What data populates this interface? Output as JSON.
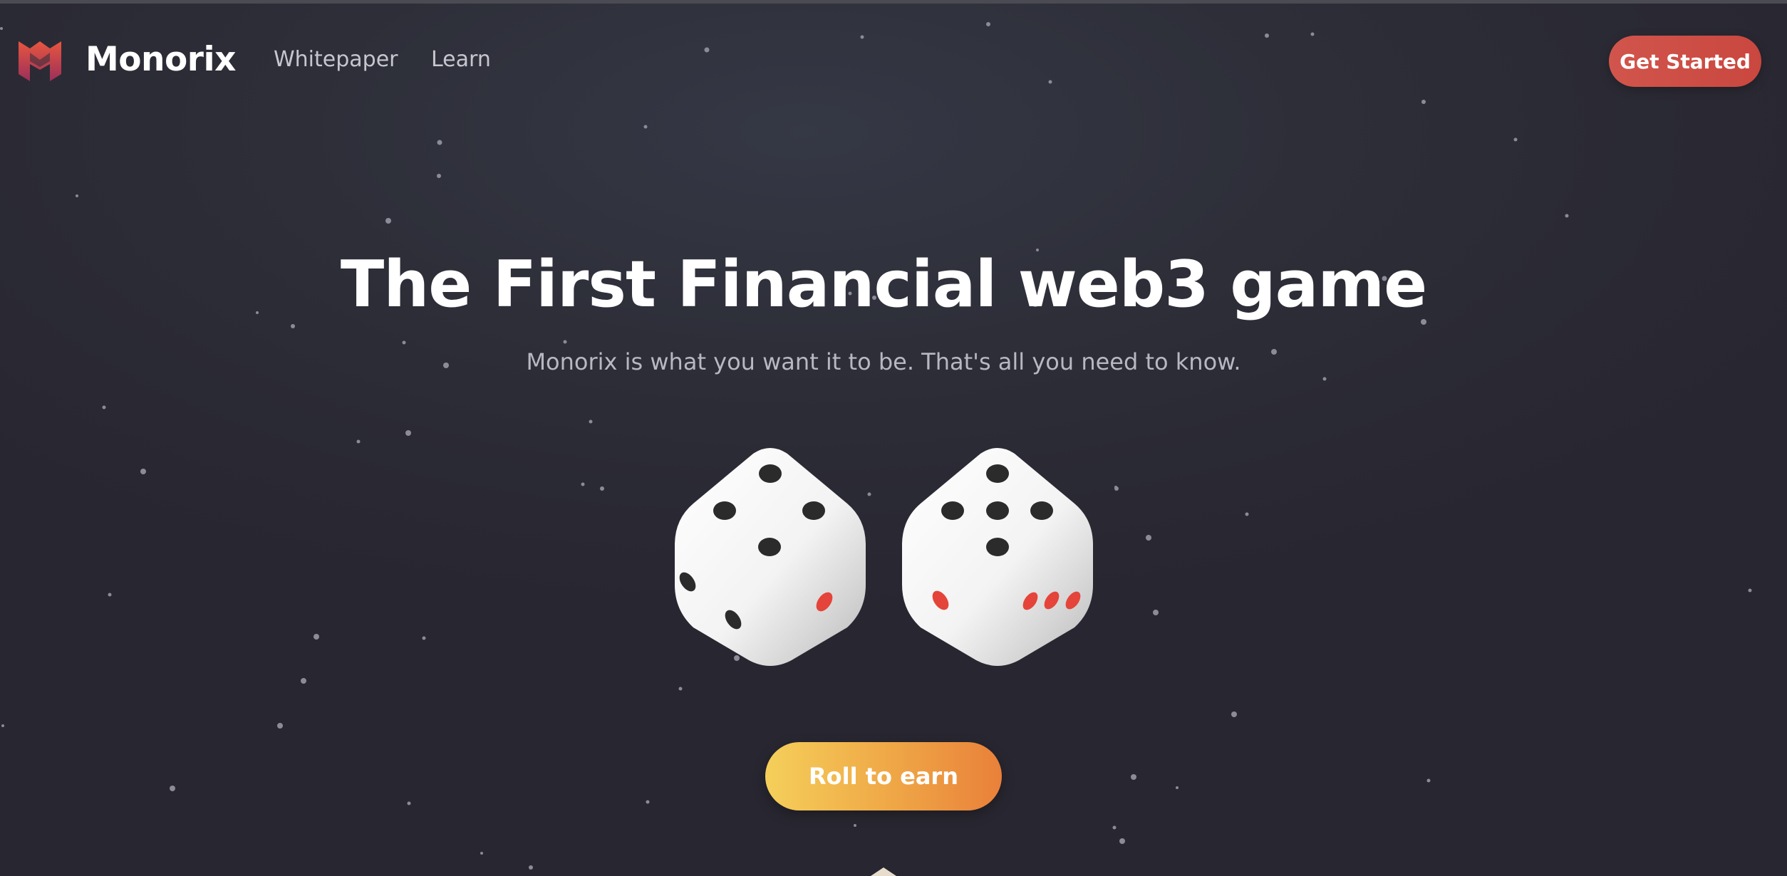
{
  "brand": {
    "name": "Monorix",
    "logo_icon": "monorix-logo-icon"
  },
  "nav": {
    "links": [
      {
        "label": "Whitepaper"
      },
      {
        "label": "Learn"
      }
    ],
    "cta_label": "Get Started"
  },
  "hero": {
    "title": "The First Financial web3 game",
    "subtitle": "Monorix is what you want it to be. That's all you need to know.",
    "dice": [
      {
        "name": "die-left",
        "icon": "dice-icon"
      },
      {
        "name": "die-right",
        "icon": "dice-icon"
      }
    ],
    "cta_label": "Roll to earn"
  },
  "colors": {
    "background": "#2d2e38",
    "primary_button": "#d1554c",
    "roll_gradient_start": "#f5cf5a",
    "roll_gradient_end": "#e9803a",
    "pip_dark": "#2b2b2b",
    "pip_red": "#e4443a",
    "text_muted": "#b7b8c1"
  }
}
